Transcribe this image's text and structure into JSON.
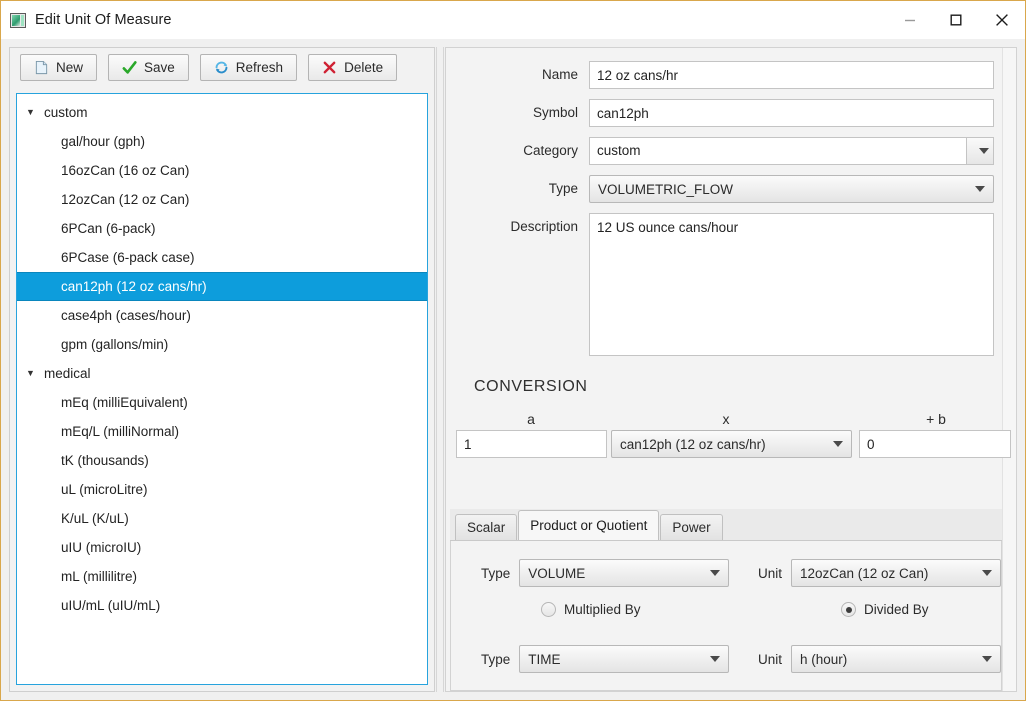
{
  "window": {
    "title": "Edit Unit Of Measure",
    "icon": "app-image-icon",
    "border_color": "#d9a74c",
    "controls": {
      "minimize": "minimize-icon",
      "maximize": "maximize-icon",
      "close": "close-icon"
    }
  },
  "toolbar": {
    "buttons": [
      {
        "label": "New",
        "icon": "new-page-icon"
      },
      {
        "label": "Save",
        "icon": "green-check-icon"
      },
      {
        "label": "Refresh",
        "icon": "blue-refresh-icon"
      },
      {
        "label": "Delete",
        "icon": "red-x-icon"
      }
    ]
  },
  "tree": {
    "selection_color": "#0d9ddc",
    "focus_border_color": "#27a3dd",
    "nodes": [
      {
        "label": "custom",
        "type": "group",
        "expanded": true,
        "twisty": "▼"
      },
      {
        "label": "gal/hour (gph)",
        "type": "leaf"
      },
      {
        "label": "16ozCan (16 oz Can)",
        "type": "leaf"
      },
      {
        "label": "12ozCan (12 oz Can)",
        "type": "leaf"
      },
      {
        "label": "6PCan (6-pack)",
        "type": "leaf"
      },
      {
        "label": "6PCase (6-pack case)",
        "type": "leaf"
      },
      {
        "label": "can12ph (12 oz cans/hr)",
        "type": "leaf",
        "selected": true
      },
      {
        "label": "case4ph (cases/hour)",
        "type": "leaf"
      },
      {
        "label": "gpm (gallons/min)",
        "type": "leaf"
      },
      {
        "label": "medical",
        "type": "group",
        "expanded": true,
        "twisty": "▼"
      },
      {
        "label": "mEq (milliEquivalent)",
        "type": "leaf"
      },
      {
        "label": "mEq/L (milliNormal)",
        "type": "leaf"
      },
      {
        "label": "tK (thousands)",
        "type": "leaf"
      },
      {
        "label": "uL (microLitre)",
        "type": "leaf"
      },
      {
        "label": "K/uL (K/uL)",
        "type": "leaf"
      },
      {
        "label": "uIU (microIU)",
        "type": "leaf"
      },
      {
        "label": "mL (millilitre)",
        "type": "leaf"
      },
      {
        "label": "uIU/mL (uIU/mL)",
        "type": "leaf"
      }
    ]
  },
  "form": {
    "name": {
      "label": "Name",
      "value": "12 oz cans/hr",
      "placeholder": ""
    },
    "symbol": {
      "label": "Symbol",
      "value": "can12ph",
      "placeholder": ""
    },
    "category": {
      "label": "Category",
      "value": "custom",
      "control": "editable-combobox"
    },
    "type": {
      "label": "Type",
      "value": "VOLUMETRIC_FLOW",
      "control": "combobox"
    },
    "description": {
      "label": "Description",
      "value": "12 US ounce cans/hour",
      "placeholder": ""
    }
  },
  "conversion": {
    "title": "CONVERSION",
    "header_a": "a",
    "header_x": "x",
    "header_b": "+ b",
    "a_value": "1",
    "x_value": "can12ph (12 oz cans/hr)",
    "b_value": "0"
  },
  "tabs": {
    "items": [
      {
        "label": "Scalar",
        "active": false
      },
      {
        "label": "Product or Quotient",
        "active": true
      },
      {
        "label": "Power",
        "active": false
      }
    ]
  },
  "product_or_quotient": {
    "row1": {
      "type_label": "Type",
      "type_value": "VOLUME",
      "unit_label": "Unit",
      "unit_value": "12ozCan (12 oz Can)"
    },
    "operation": {
      "multiplied": {
        "label": "Multiplied By",
        "selected": false
      },
      "divided": {
        "label": "Divided By",
        "selected": true
      }
    },
    "row2": {
      "type_label": "Type",
      "type_value": "TIME",
      "unit_label": "Unit",
      "unit_value": "h (hour)"
    }
  }
}
